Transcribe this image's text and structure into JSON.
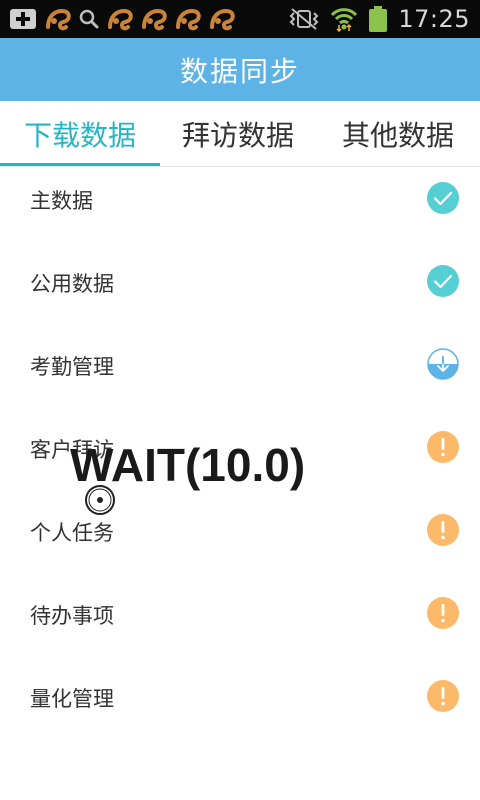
{
  "status_bar": {
    "time": "17:25",
    "left_icons": [
      "add-icon",
      "uc-squirrel-icon",
      "search-icon",
      "uc-squirrel-icon",
      "uc-squirrel-icon",
      "uc-squirrel-icon",
      "uc-squirrel-icon"
    ],
    "right_icons": [
      "vibrate-muted-icon",
      "wifi-icon",
      "battery-icon"
    ]
  },
  "header": {
    "title": "数据同步"
  },
  "tabs": [
    {
      "label": "下载数据",
      "active": true
    },
    {
      "label": "拜访数据",
      "active": false
    },
    {
      "label": "其他数据",
      "active": false
    }
  ],
  "items": [
    {
      "label": "主数据",
      "status": "done"
    },
    {
      "label": "公用数据",
      "status": "done"
    },
    {
      "label": "考勤管理",
      "status": "downloading"
    },
    {
      "label": "客户拜访",
      "status": "warning"
    },
    {
      "label": "个人任务",
      "status": "warning"
    },
    {
      "label": "待办事项",
      "status": "warning"
    },
    {
      "label": "量化管理",
      "status": "warning"
    }
  ],
  "overlay": {
    "text": "WAIT(10.0)"
  },
  "colors": {
    "header_bg": "#5db3e6",
    "accent": "#26b5c6",
    "done": "#56cfd4",
    "downloading": "#5db3e6",
    "warning": "#fdb96a"
  }
}
